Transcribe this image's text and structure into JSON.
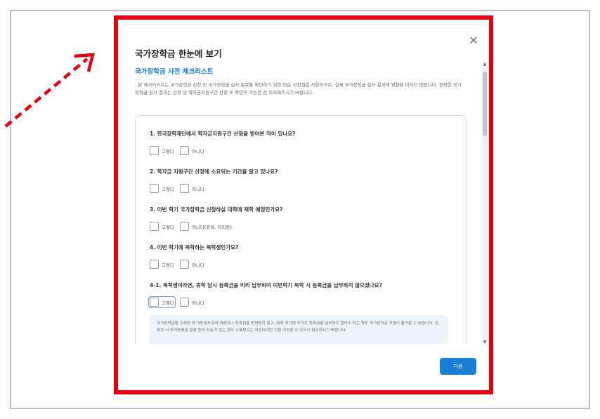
{
  "modal": {
    "title": "국가장학금 한눈에 보기",
    "close_label": "✕",
    "section_title": "국가장학금 사전 체크리스트",
    "intro": "- 본 체크리스트는 국가장학금 신청 전 국가장학금 심사 항목을 확인하기 위한 단순 사전점검 사항이므로, 실제 국가장학금 심사 결과에 영향을 미치지 않습니다. 정확한 국가장학금 심사 결과는 신청 및 학자금지원구간 산정 후 확인이 가능한 점 유의해주시기 바랍니다.",
    "questions": [
      {
        "title": "1. 한국장학재단에서 학자금지원구간 산정을 받아본 적이 있나요?",
        "yes": "그렇다",
        "no": "아니다"
      },
      {
        "title": "2. 학자금 지원구간 산정에 소요되는 기간을 알고 있나요?",
        "yes": "그렇다",
        "no": "아니다"
      },
      {
        "title": "3. 이번 학기 국가장학금 신청하실 대학에 재학 예정인가요?",
        "yes": "그렇다",
        "no": "아니다(휴학, 자퇴등)"
      },
      {
        "title": "4. 이번 학기에 복학하는 복학생인가요?",
        "yes": "그렇다",
        "no": "아니다"
      },
      {
        "title": "4-1. 복학생이라면, 휴학 당시 등록금을 미리 납부하여 이번학기 복학 시 등록금을 납부하지 않으셨나요?",
        "yes": "그렇다",
        "no": "아니다"
      }
    ],
    "note": "국가장학금을 수혜한 학기에 중도휴학 하였으나 등록금을 반환받지 않고, 복학 학기에 추가로 등록금을 납부하지 않아도 되는 경우 국가장학금 지원이 불가할 수 있습니다. 단, 복학 시 추가등록금 발생 등의 사유가 있는 경우 수혜횟수는 차감되지만 지원 가능할 수 있으니 참고하시기 바랍니다.",
    "next_label": "다음"
  },
  "colors": {
    "accent": "#1a7fd4",
    "highlight_frame": "#e60012",
    "annotation_arrow": "#e60012"
  }
}
